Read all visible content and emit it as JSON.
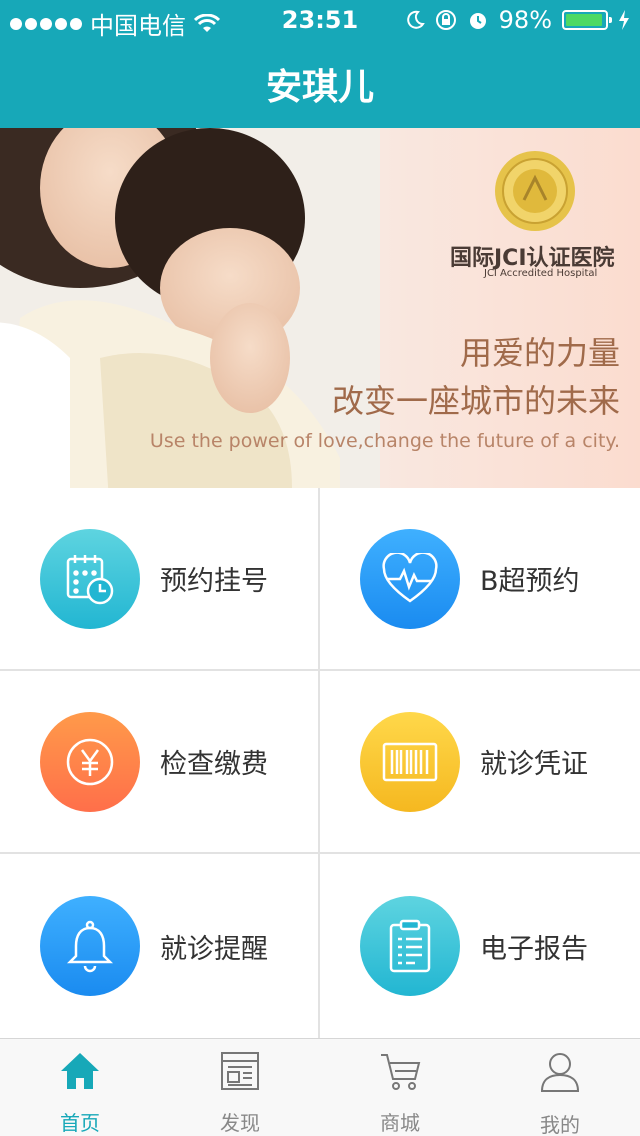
{
  "status_bar": {
    "carrier": "中国电信",
    "time": "23:51",
    "battery": "98%",
    "battery_level": 0.98
  },
  "nav": {
    "title": "安琪儿"
  },
  "banner": {
    "jci_title": "国际JCI认证医院",
    "jci_subtitle": "JCI Accredited Hospital",
    "slogan_line1": "用爱的力量",
    "slogan_line2": "改变一座城市的未来",
    "slogan_en": "Use the power of love,change the future of a city."
  },
  "services": [
    {
      "label": "预约挂号",
      "icon": "calendar-clock-icon",
      "color": "#22b6d2"
    },
    {
      "label": "B超预约",
      "icon": "heart-pulse-icon",
      "color": "#1a8bf0"
    },
    {
      "label": "检查缴费",
      "icon": "yuan-coin-icon",
      "color": "#ff6f4a"
    },
    {
      "label": "就诊凭证",
      "icon": "barcode-icon",
      "color": "#f5b820"
    },
    {
      "label": "就诊提醒",
      "icon": "bell-icon",
      "color": "#1a8bf0"
    },
    {
      "label": "电子报告",
      "icon": "clipboard-report-icon",
      "color": "#22b6d2"
    }
  ],
  "tabs": [
    {
      "label": "首页",
      "icon": "home-icon",
      "active": true
    },
    {
      "label": "发现",
      "icon": "newspaper-icon",
      "active": false
    },
    {
      "label": "商城",
      "icon": "cart-icon",
      "active": false
    },
    {
      "label": "我的",
      "icon": "user-icon",
      "active": false
    }
  ],
  "colors": {
    "brand": "#17a8b8",
    "active_tab": "#17a8b8",
    "inactive_tab": "#888888"
  }
}
